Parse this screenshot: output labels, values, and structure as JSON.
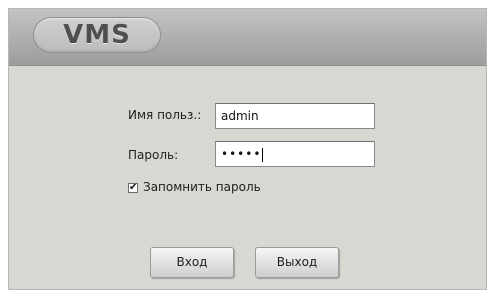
{
  "app": {
    "logo_text": "VMS"
  },
  "login": {
    "username_label": "Имя польз.:",
    "username_value": "admin",
    "password_label": "Пароль:",
    "password_masked": "•••••",
    "remember_label": "Запомнить пароль",
    "remember_checked": true,
    "remember_mark": "✔",
    "login_button": "Вход",
    "exit_button": "Выход"
  },
  "colors": {
    "window_bg": "#d9d7d2",
    "header_gradient_top": "#c4c4c4",
    "header_gradient_bottom": "#9d9d9d",
    "logo_text": "#4f4f4f"
  }
}
